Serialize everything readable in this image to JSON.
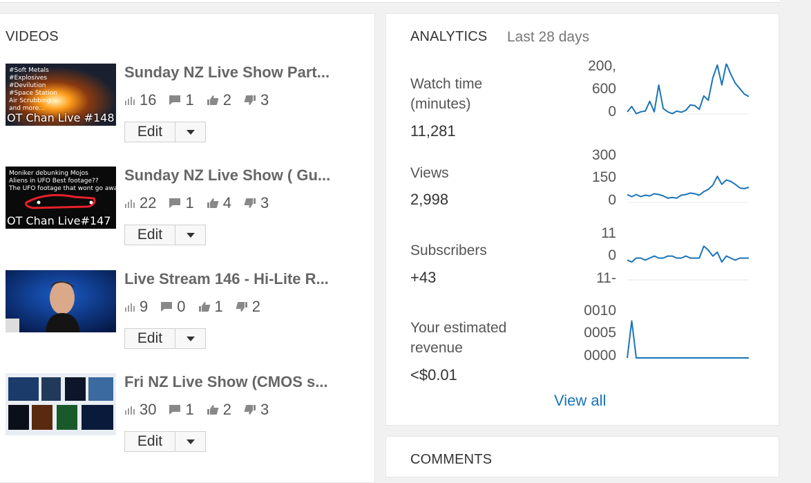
{
  "videos": {
    "title": "VIDEOS",
    "items": [
      {
        "title": "Sunday NZ Live Show Part...",
        "views": "16",
        "comments": "1",
        "likes": "2",
        "dislikes": "3",
        "thumb_caption": "OT Chan Live #148",
        "thumb_text": "#Soft Metals\n#Explosives\n#Devilution\n#Space Station\nAir Scrubbing\nand more..."
      },
      {
        "title": "Sunday NZ Live Show ( Gu...",
        "views": "22",
        "comments": "1",
        "likes": "4",
        "dislikes": "3",
        "thumb_caption": "OT Chan Live#147",
        "thumb_text": "Moniker debunking Mojos\nAliens in UFO Best footage??\nThe UFO footage that wont go away"
      },
      {
        "title": "Live Stream 146 - Hi-Lite R...",
        "views": "9",
        "comments": "0",
        "likes": "1",
        "dislikes": "2",
        "thumb_caption": "",
        "thumb_text": ""
      },
      {
        "title": "Fri NZ Live Show (CMOS s...",
        "views": "30",
        "comments": "1",
        "likes": "2",
        "dislikes": "3",
        "thumb_caption": "",
        "thumb_text": ""
      }
    ],
    "edit_label": "Edit"
  },
  "analytics": {
    "title": "ANALYTICS",
    "range": "Last 28 days",
    "metrics": [
      {
        "label_line1": "Watch time",
        "label_line2": "(minutes)",
        "value": "11,281",
        "axis": [
          ",200",
          "600",
          "0"
        ]
      },
      {
        "label_line1": "Views",
        "label_line2": "",
        "value": "2,998",
        "axis": [
          "300",
          "150",
          "0"
        ]
      },
      {
        "label_line1": "Subscribers",
        "label_line2": "",
        "value": "+43",
        "axis": [
          "11",
          "0",
          "-11"
        ]
      },
      {
        "label_line1": "Your estimated",
        "label_line2": "revenue",
        "value": "<$0.01",
        "axis": [
          "0010",
          "0005",
          "0000"
        ]
      }
    ],
    "view_all": "View all"
  },
  "comments": {
    "title": "COMMENTS"
  },
  "chart_data": [
    {
      "type": "line",
      "title": "Watch time (minutes)",
      "ylim": [
        0,
        1200
      ],
      "values": [
        60,
        210,
        10,
        60,
        80,
        350,
        60,
        800,
        150,
        60,
        10,
        80,
        50,
        100,
        250,
        230,
        130,
        500,
        380,
        1000,
        1350,
        800,
        1450,
        1100,
        850,
        700,
        550,
        480
      ]
    },
    {
      "type": "line",
      "title": "Views",
      "ylim": [
        0,
        300
      ],
      "values": [
        55,
        40,
        55,
        40,
        50,
        45,
        60,
        55,
        45,
        30,
        35,
        30,
        50,
        55,
        65,
        60,
        50,
        75,
        90,
        120,
        180,
        125,
        155,
        145,
        125,
        100,
        95,
        105
      ]
    },
    {
      "type": "line",
      "title": "Subscribers",
      "ylim": [
        -11,
        11
      ],
      "values": [
        -1,
        -2,
        0,
        0,
        -1,
        0,
        1,
        0,
        0,
        1,
        1,
        0,
        0,
        1,
        0,
        0,
        0,
        6,
        4,
        1,
        3,
        -2,
        1,
        0,
        -1,
        0,
        0,
        0
      ]
    },
    {
      "type": "line",
      "title": "Your estimated revenue",
      "ylim": [
        0,
        0.01
      ],
      "values": [
        0,
        0.0085,
        0,
        0,
        0,
        0,
        0,
        0,
        0,
        0,
        0,
        0,
        0,
        0,
        0,
        0,
        0,
        0,
        0,
        0,
        0,
        0,
        0,
        0,
        0,
        0,
        0,
        0
      ]
    }
  ]
}
